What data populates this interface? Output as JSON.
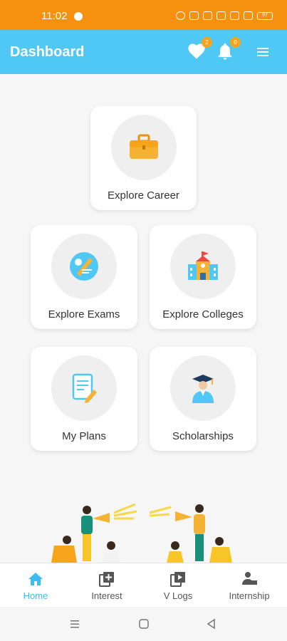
{
  "status": {
    "time": "11:02",
    "battery": "97"
  },
  "appbar": {
    "title": "Dashboard",
    "favorites_badge": "2",
    "notifications_badge": "0"
  },
  "cards": {
    "career": "Explore Career",
    "exams": "Explore Exams",
    "colleges": "Explore Colleges",
    "plans": "My Plans",
    "scholarships": "Scholarships"
  },
  "nav": {
    "items": [
      {
        "label": "Home",
        "icon": "home-icon",
        "active": true
      },
      {
        "label": "Interest",
        "icon": "add-box-icon",
        "active": false
      },
      {
        "label": "V Logs",
        "icon": "video-library-icon",
        "active": false
      },
      {
        "label": "Internship",
        "icon": "person-laptop-icon",
        "active": false
      }
    ]
  },
  "colors": {
    "statusbar": "#f6900f",
    "appbar": "#4fc8f5",
    "accent": "#3bbdf0",
    "badge": "#f6a51a"
  }
}
